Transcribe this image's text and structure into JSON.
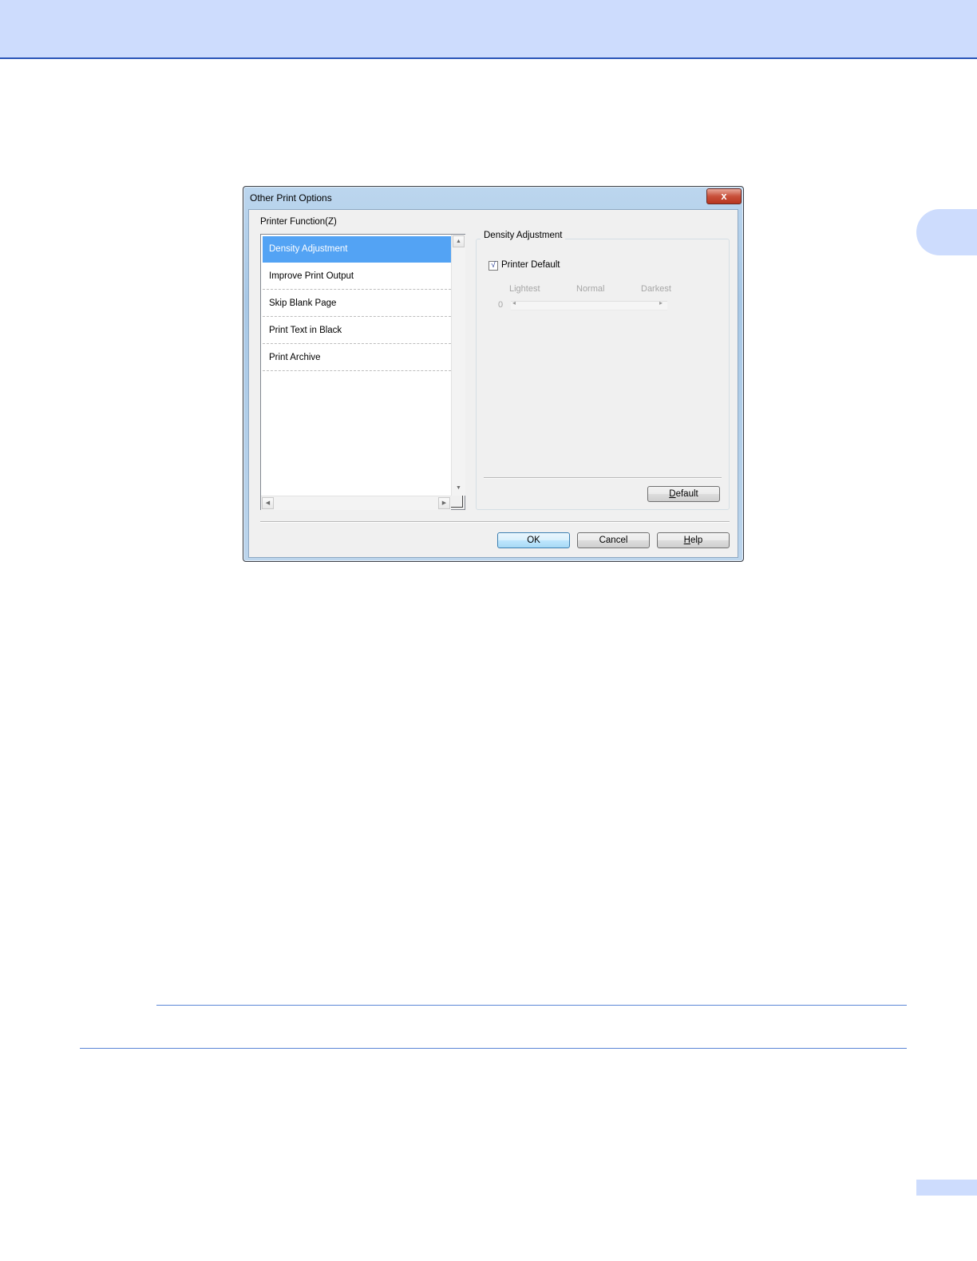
{
  "dialog": {
    "title": "Other Print Options",
    "close_glyph": "x"
  },
  "printer_function": {
    "label": "Printer Function(Z)",
    "items": [
      {
        "label": "Density Adjustment",
        "selected": true
      },
      {
        "label": "Improve Print Output",
        "selected": false
      },
      {
        "label": "Skip Blank Page",
        "selected": false
      },
      {
        "label": "Print Text in Black",
        "selected": false
      },
      {
        "label": "Print Archive",
        "selected": false
      }
    ]
  },
  "density": {
    "group_title": "Density Adjustment",
    "printer_default_label": "Printer Default",
    "printer_default_checked": true,
    "check_glyph": "√",
    "scale_labels": {
      "lightest": "Lightest",
      "normal": "Normal",
      "darkest": "Darkest"
    },
    "value": "0",
    "default_button": {
      "first": "D",
      "rest": "efault"
    }
  },
  "buttons": {
    "ok": "OK",
    "cancel": "Cancel",
    "help": {
      "first": "H",
      "rest": "elp"
    }
  },
  "colors": {
    "header_band": "#cddcfd",
    "selection": "#53a3f4",
    "close_button": "#c8503a"
  }
}
